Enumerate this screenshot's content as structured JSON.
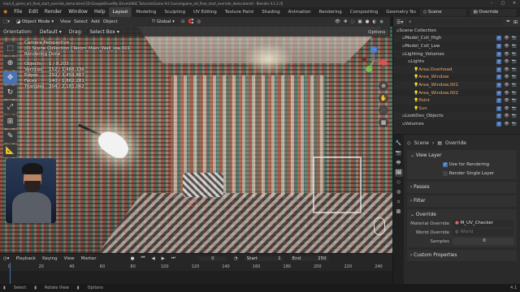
{
  "titlebar": {
    "text": "mod_6_game_art_final_start_override_demo.blend [D:\\GoogleDrive\\My Drive\\UNSC Tutorials\\Game Art Course\\game_art_final_start_override_demo.blend] - Blender 4.1.2 (f)",
    "controls": [
      "–",
      "□",
      "✕"
    ]
  },
  "menubar": {
    "menus": [
      "File",
      "Edit",
      "Render",
      "Window",
      "Help"
    ],
    "workspaces": [
      "Layout",
      "Modeling",
      "Sculpting",
      "UV Editing",
      "Texture Paint",
      "Shading",
      "Animation",
      "Rendering",
      "Compositing",
      "Geometry No"
    ],
    "active_workspace": "Layout",
    "scene": "Scene",
    "view_layer": "Override"
  },
  "viewport_header": {
    "mode": "Object Mode",
    "menus": [
      "View",
      "Select",
      "Add",
      "Object"
    ],
    "transform": "Global"
  },
  "viewport_header2": {
    "orientation_label": "Orientation:",
    "orientation": "Default",
    "drag_label": "Drag:",
    "drag": "Select Box",
    "options": "Options"
  },
  "stats": {
    "camera": "Camera Perspective",
    "collection": "(0) Scene Collection | Room_Main_Wall_low.001",
    "status": "Rendering Done",
    "rows": [
      {
        "label": "Objects",
        "value": "1 / 8,203"
      },
      {
        "label": "Vertices",
        "value": "152 / 1,466,136"
      },
      {
        "label": "Edges",
        "value": "292 / 3,459,867"
      },
      {
        "label": "Faces",
        "value": "140 / 1,862,281"
      },
      {
        "label": "Triangles",
        "value": "304 / 2,181,062"
      }
    ]
  },
  "tools": [
    "cursor",
    "move",
    "rotate",
    "scale",
    "transform",
    "annotate",
    "measure",
    "add"
  ],
  "outliner": {
    "search_placeholder": "",
    "rows": [
      {
        "name": "Scene Collection",
        "indent": 0,
        "type": "collection"
      },
      {
        "name": "Model_Coll_High",
        "indent": 1,
        "type": "collection"
      },
      {
        "name": "Model_Coll_Low",
        "indent": 1,
        "type": "collection"
      },
      {
        "name": "Lighting_Volumes",
        "indent": 1,
        "type": "collection"
      },
      {
        "name": "Lights",
        "indent": 2,
        "type": "collection"
      },
      {
        "name": "Area.Overhead",
        "indent": 3,
        "type": "light"
      },
      {
        "name": "Area_Window",
        "indent": 3,
        "type": "light"
      },
      {
        "name": "Area_Window.001",
        "indent": 3,
        "type": "light"
      },
      {
        "name": "Area_Window.002",
        "indent": 3,
        "type": "light"
      },
      {
        "name": "Point",
        "indent": 3,
        "type": "light"
      },
      {
        "name": "Sun",
        "indent": 3,
        "type": "light"
      },
      {
        "name": "LookDev_Objects",
        "indent": 1,
        "type": "collection"
      },
      {
        "name": "Volumes",
        "indent": 1,
        "type": "collection"
      }
    ]
  },
  "properties": {
    "header_scene": "Scene",
    "header_layer": "Override",
    "view_layer": {
      "title": "View Layer",
      "use_for_rendering": "Use for Rendering",
      "render_single_layer": "Render Single Layer"
    },
    "passes": "Passes",
    "filter": "Filter",
    "override": {
      "title": "Override",
      "material_override_label": "Material Override",
      "material_override_value": "M_UV_Checker",
      "world_override_label": "World Override",
      "world_override_placeholder": "World",
      "samples_label": "Samples",
      "samples_value": "0"
    },
    "custom_properties": "Custom Properties"
  },
  "timeline": {
    "menus": [
      "Playback",
      "Keying",
      "View",
      "Marker"
    ],
    "current_frame": "0",
    "start_label": "Start",
    "start": "1",
    "end_label": "End",
    "end": "250",
    "ticks": [
      "0",
      "20",
      "40",
      "60",
      "80",
      "100",
      "120",
      "140",
      "160",
      "180",
      "200",
      "220",
      "240"
    ]
  },
  "statusbar": {
    "items": [
      "Select",
      "Rotate View",
      "Options"
    ],
    "version": "4.1"
  }
}
